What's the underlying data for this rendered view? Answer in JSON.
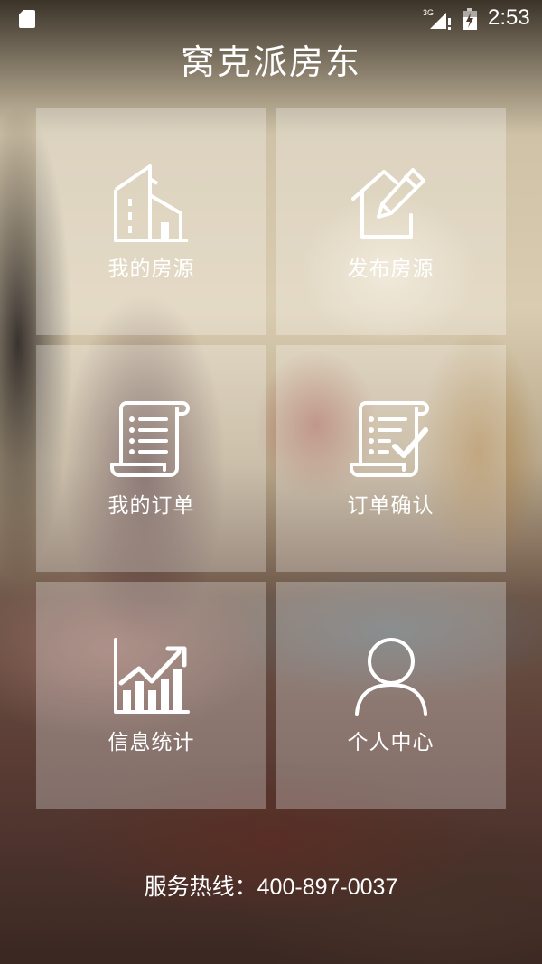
{
  "status_bar": {
    "network": "3G",
    "time": "2:53"
  },
  "app_title": "窝克派房东",
  "tiles": [
    {
      "label": "我的房源",
      "icon": "building-icon"
    },
    {
      "label": "发布房源",
      "icon": "house-edit-icon"
    },
    {
      "label": "我的订单",
      "icon": "scroll-list-icon"
    },
    {
      "label": "订单确认",
      "icon": "scroll-check-icon"
    },
    {
      "label": "信息统计",
      "icon": "growth-chart-icon"
    },
    {
      "label": "个人中心",
      "icon": "user-icon"
    }
  ],
  "hotline": {
    "prefix": "服务热线：",
    "number": "400-897-0037"
  },
  "colors": {
    "tile_background": "rgba(255,255,255,0.28)",
    "text": "#ffffff"
  }
}
